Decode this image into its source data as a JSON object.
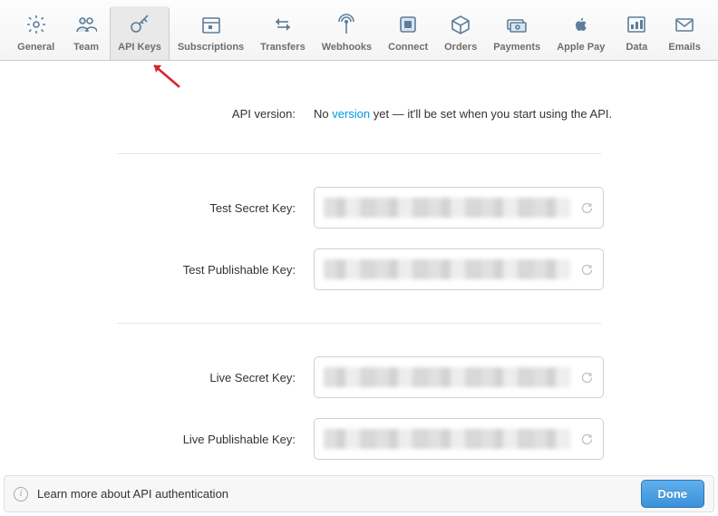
{
  "tabs": [
    {
      "name": "general",
      "label": "General"
    },
    {
      "name": "team",
      "label": "Team"
    },
    {
      "name": "api-keys",
      "label": "API Keys",
      "active": true
    },
    {
      "name": "subscriptions",
      "label": "Subscriptions"
    },
    {
      "name": "transfers",
      "label": "Transfers"
    },
    {
      "name": "webhooks",
      "label": "Webhooks"
    },
    {
      "name": "connect",
      "label": "Connect"
    },
    {
      "name": "orders",
      "label": "Orders"
    },
    {
      "name": "payments",
      "label": "Payments"
    },
    {
      "name": "apple-pay",
      "label": "Apple Pay"
    },
    {
      "name": "data",
      "label": "Data"
    },
    {
      "name": "emails",
      "label": "Emails"
    }
  ],
  "api_version": {
    "label": "API version:",
    "text_prefix": "No ",
    "link": "version",
    "text_suffix": " yet — it'll be set when you start using the API."
  },
  "keys": {
    "test_secret": {
      "label": "Test Secret Key:"
    },
    "test_publishable": {
      "label": "Test Publishable Key:"
    },
    "live_secret": {
      "label": "Live Secret Key:"
    },
    "live_publishable": {
      "label": "Live Publishable Key:"
    }
  },
  "footer": {
    "info_text": "Learn more about API authentication",
    "done_label": "Done"
  }
}
